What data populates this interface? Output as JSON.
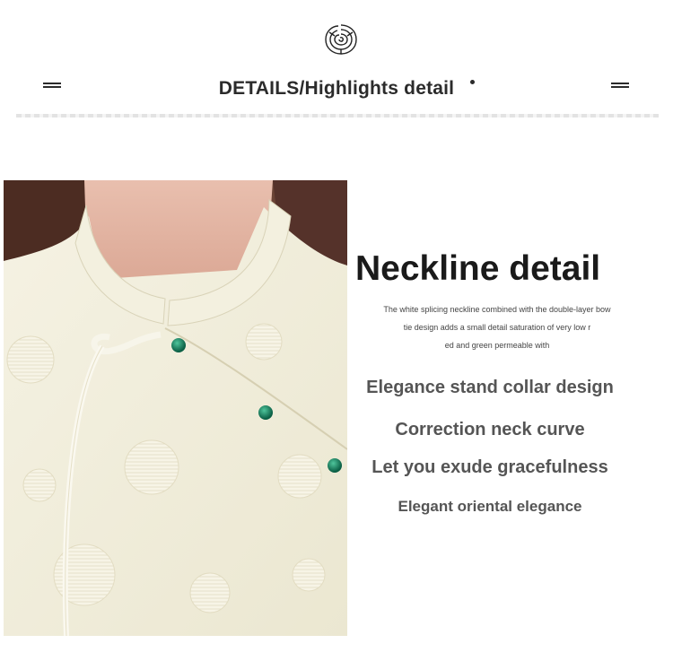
{
  "header": {
    "title": "DETAILS/Highlights detail"
  },
  "icons": {
    "logo": "rose-logo-icon",
    "left_ornament": "double-bar-icon",
    "right_ornament": "double-bar-icon"
  },
  "product": {
    "heading": "Neckline detail",
    "description": [
      "The white splicing neckline combined with the double-layer bow",
      "tie design adds a small detail saturation of very low r",
      "ed and green permeable with"
    ],
    "features": [
      "Elegance stand collar design",
      "Correction neck curve",
      "Let you exude gracefulness",
      "Elegant oriental elegance"
    ]
  },
  "colors": {
    "text_dark": "#1a1a1a",
    "text_gray": "#555555",
    "fabric": "#f1eedc",
    "button_green": "#0e7a5a",
    "hair": "#5a3628"
  }
}
